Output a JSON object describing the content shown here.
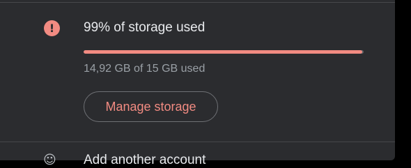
{
  "storage_alert": {
    "icon": "alert-icon",
    "icon_glyph": "!",
    "title": "99% of storage used",
    "used_fraction": 0.9947,
    "usage_text": "14,92 GB of 15 GB used",
    "manage_button_label": "Manage storage"
  },
  "account_menu": {
    "add_account_icon": "add-person-icon",
    "add_account_label": "Add another account"
  },
  "colors": {
    "panel_background": "#2b2c2f",
    "alert_accent": "#f28b82",
    "primary_text": "#e8eaed",
    "secondary_text": "#9aa0a6"
  }
}
